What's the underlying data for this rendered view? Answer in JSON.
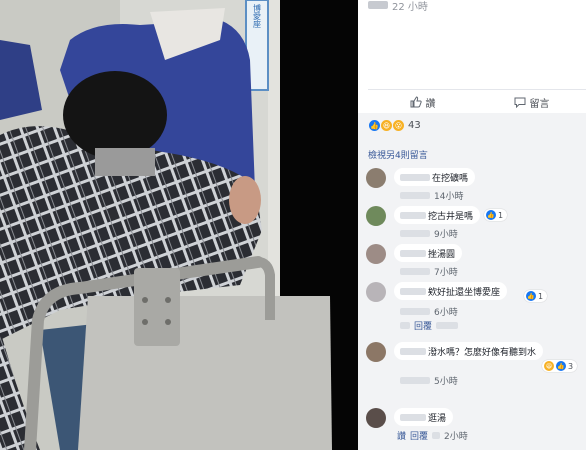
{
  "post": {
    "time": "22 小時"
  },
  "actions": {
    "like": "讚",
    "comment": "留言"
  },
  "reactions": {
    "count": "43"
  },
  "view_more": "檢視另4則留言",
  "photo": {
    "sign_text": "博愛座"
  },
  "comments": [
    {
      "text": "在挖礦嗎",
      "time": "14小時",
      "reply": "",
      "like": "",
      "badge": ""
    },
    {
      "text": "挖古井是嗎",
      "time": "9小時",
      "reply": "",
      "like": "",
      "badge": "1"
    },
    {
      "text": "挫湯圓",
      "time": "7小時",
      "reply": "",
      "like": "",
      "badge": ""
    },
    {
      "text": "欸好扯還坐博愛座",
      "time": "6小時",
      "reply": "回覆",
      "like": "",
      "badge": "1"
    },
    {
      "text": "潑水嗎？怎麼好像有聽到水",
      "time": "5小時",
      "reply": "",
      "like": "",
      "badge": "3"
    },
    {
      "text": "逛湯",
      "time": "2小時",
      "reply": "回覆",
      "like": "讚",
      "badge": ""
    }
  ],
  "colors": {
    "link": "#385898",
    "like": "#1877f2",
    "haha": "#f7b125",
    "strip": "#f2f3f5"
  }
}
